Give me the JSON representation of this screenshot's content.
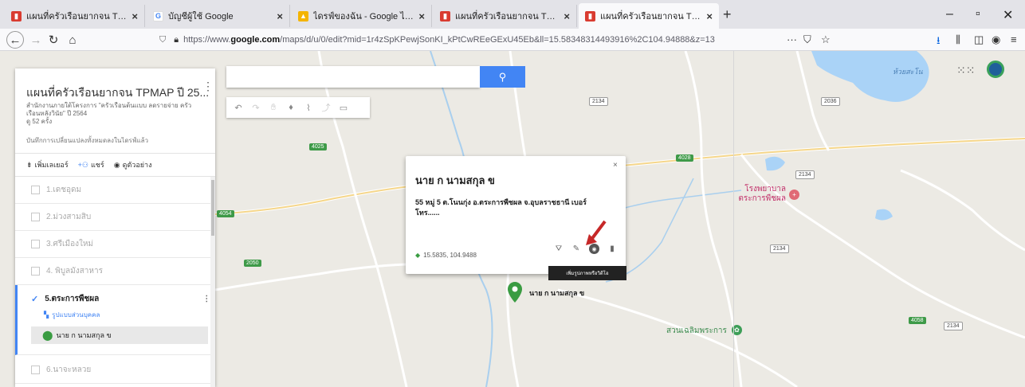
{
  "tabs": [
    {
      "title": "แผนที่ครัวเรือนยากจน TPMAP ปี",
      "favicon": "mymaps-icon",
      "active": false
    },
    {
      "title": "บัญชีผู้ใช้ Google",
      "favicon": "google-icon",
      "active": false
    },
    {
      "title": "ไดรฟ์ของฉัน - Google ไดรฟ์",
      "favicon": "drive-icon",
      "active": false
    },
    {
      "title": "แผนที่ครัวเรือนยากจน TPMAP ปี",
      "favicon": "mymaps-icon",
      "active": false
    },
    {
      "title": "แผนที่ครัวเรือนยากจน TPMAP ปี",
      "favicon": "mymaps-icon",
      "active": true
    }
  ],
  "nav": {
    "url_prefix": "https://www.",
    "url_host": "google.com",
    "url_rest": "/maps/d/u/0/edit?mid=1r4zSpKPewjSonKI_kPtCwREeGExU45Eb&ll=15.58348314493916%2C104.94888&z=13"
  },
  "panel": {
    "title": "แผนที่ครัวเรือนยากจน TPMAP ปี 25...",
    "description": "สำนักงานภายใต้โครงการ \"ครัวเรือนต้นแบบ ลดรายจ่าย ครัวเรือนหลังวินัย\" ปี 2564",
    "views": "ดู 52 ครั้ง",
    "changes": "บันทึกการเปลี่ยนแปลงทั้งหมดลงในไดรฟ์แล้ว",
    "actions": {
      "add_layer": "เพิ่มเลเยอร์",
      "share": "แชร์",
      "preview": "ดูตัวอย่าง"
    },
    "layers": [
      {
        "label": "1.เดชอุดม"
      },
      {
        "label": "2.ม่วงสามสิบ"
      },
      {
        "label": "3.ศรีเมืองใหม่"
      },
      {
        "label": "4. พิบูลมังสาหาร"
      }
    ],
    "active_layer": {
      "label": "5.ตระการพืชผล",
      "style": "รูปแบบส่วนบุคคล",
      "feature": "นาย ก นามสกุล ข"
    },
    "next_layer": {
      "label": "6.นาจะหลวย"
    }
  },
  "toolbar": {
    "search_placeholder": "",
    "search_icon": "search-icon"
  },
  "info": {
    "title": "นาย ก นามสกุล ข",
    "address": "55 หมู่ 5 ต.โนนกุ่ง อ.ตระการพืชผล จ.อุบลราชธานี เบอร์โทร......",
    "coords": "15.5835, 104.9488",
    "tooltip": "เพิ่มรูปภาพหรือวิดีโอ"
  },
  "marker": {
    "label": "นาย ก นามสกุล ข"
  },
  "map_labels": {
    "hospital": "โรงพยาบาล\nตระการพืชผล",
    "park": "สวนเฉลิมพระการ",
    "lake": "ห้วยสะโน"
  },
  "road_badges": [
    "2134",
    "4025",
    "4028",
    "4054",
    "2050",
    "2036",
    "2134",
    "2134",
    "4058",
    "2134"
  ],
  "colors": {
    "accent": "#4285f4",
    "marker": "#3a9c42",
    "water": "#aad3f7",
    "road_green": "#3e9a48"
  }
}
